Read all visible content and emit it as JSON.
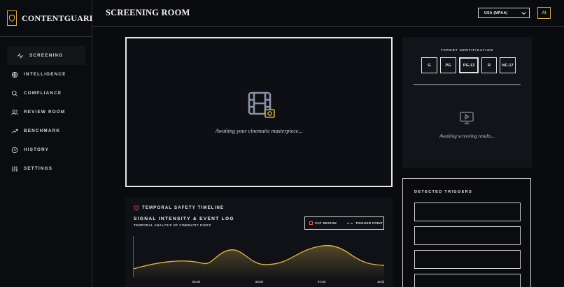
{
  "app": {
    "name": "CONTENTGUARD"
  },
  "sidebar": {
    "items": [
      {
        "label": "SCREENING",
        "icon": "pulse-icon",
        "active": true
      },
      {
        "label": "INTELLIGENCE",
        "icon": "globe-icon"
      },
      {
        "label": "COMPLIANCE",
        "icon": "search-icon"
      },
      {
        "label": "REVIEW ROOM",
        "icon": "users-icon"
      },
      {
        "label": "BENCHMARK",
        "icon": "trend-up-icon"
      },
      {
        "label": "HISTORY",
        "icon": "clock-icon"
      },
      {
        "label": "SETTINGS",
        "icon": "sliders-icon"
      }
    ]
  },
  "header": {
    "title": "SCREENING ROOM",
    "region": "USA (MPAA)",
    "ai_label": "AI"
  },
  "upload": {
    "placeholder": "Awaiting your cinematic masterpiece..."
  },
  "certification": {
    "title": "TARGET CERTIFICATION",
    "ratings": [
      "G",
      "PG",
      "PG-13",
      "R",
      "NC-17"
    ],
    "selected": "PG-13",
    "results_text": "Awaiting screening results..."
  },
  "triggers": {
    "title": "DETECTED TRIGGERS",
    "slots": 4
  },
  "timeline": {
    "header": "TEMPORAL SAFETY TIMELINE",
    "title": "SIGNAL INTENSITY & EVENT LOG",
    "subtitle": "TEMPORAL ANALYSIS OF CINEMATIC RISKS",
    "legend": {
      "cut_region": "CUT REGION",
      "trigger_point": "TRIGGER POINT"
    },
    "ticks": [
      "02:30",
      "05:00",
      "07:30",
      "10:0("
    ]
  },
  "colors": {
    "accent": "#d8b04a",
    "danger": "#e05a4f",
    "bg": "#0a0b0e"
  }
}
